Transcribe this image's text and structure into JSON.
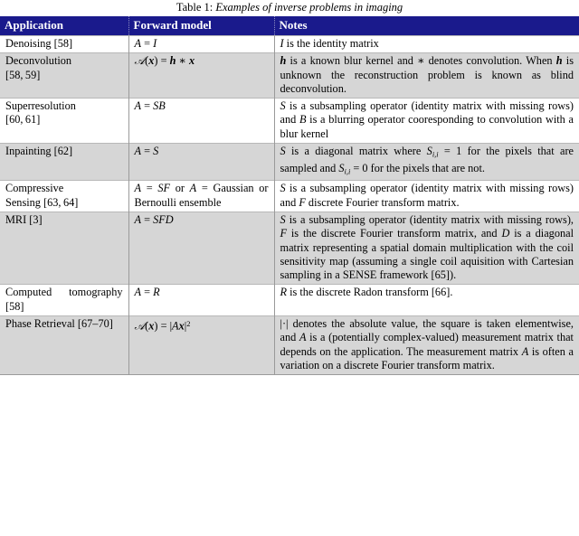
{
  "caption": {
    "label": "Table 1:",
    "text": "Examples of inverse problems in imaging"
  },
  "colors": {
    "header_background": "#1a1a8c",
    "header_text": "#ffffff",
    "alt_row_background": "#d6d6d6",
    "plain_row_background": "#ffffff",
    "rule": "#9a9a9a"
  },
  "table": {
    "headers": [
      "Application",
      "Forward model",
      "Notes"
    ],
    "rows": [
      {
        "application": "Denoising [58]",
        "forward_model": "A = I",
        "notes": "I is the identity matrix"
      },
      {
        "application": "Deconvolution [58, 59]",
        "forward_model": "A(x) = h ∗ x",
        "notes": "h is a known blur kernel and ∗ denotes convolution. When h is unknown the reconstruction problem is known as blind deconvolution."
      },
      {
        "application": "Superresolution [60, 61]",
        "forward_model": "A = SB",
        "notes": "S is a subsampling operator (identity matrix with missing rows) and B is a blurring operator cooresponding to convolution with a blur kernel"
      },
      {
        "application": "Inpainting [62]",
        "forward_model": "A = S",
        "notes": "S is a diagonal matrix where S_{i,i} = 1 for the pixels that are sampled and S_{i,i} = 0 for the pixels that are not."
      },
      {
        "application": "Compressive Sensing [63, 64]",
        "forward_model": "A = SF or A = Gaussian or Bernoulli ensemble",
        "notes": "S is a subsampling operator (identity matrix with missing rows) and F discrete Fourier transform matrix."
      },
      {
        "application": "MRI [3]",
        "forward_model": "A = SFD",
        "notes": "S is a subsampling operator (identity matrix with missing rows), F is the discrete Fourier transform matrix, and D is a diagonal matrix representing a spatial domain multiplication with the coil sensitivity map (assuming a single coil aquisition with Cartesian sampling in a SENSE framework [65])."
      },
      {
        "application": "Computed tomography [58]",
        "forward_model": "A = R",
        "notes": "R is the discrete Radon transform [66]."
      },
      {
        "application": "Phase Retrieval [67–70]",
        "forward_model": "A(x) = |Ax|^2",
        "notes": "|·| denotes the absolute value, the square is taken elementwise, and A is a (potentially complex-valued) measurement matrix that depends on the application. The measurement matrix A is often a variation on a discrete Fourier transform matrix."
      }
    ]
  }
}
